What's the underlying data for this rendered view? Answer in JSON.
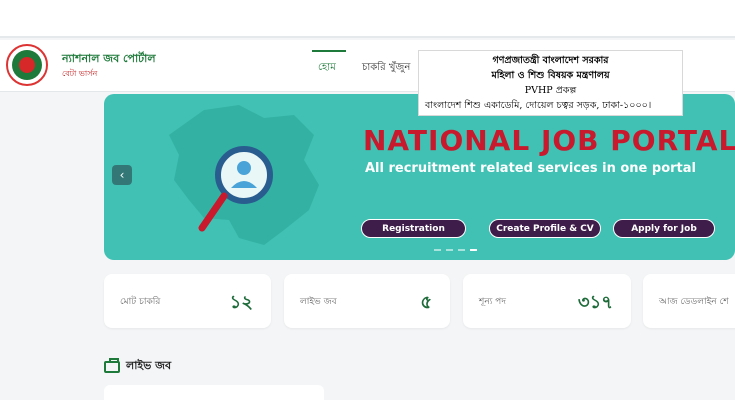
{
  "brand": {
    "title": "ন্যাশনাল জব পোর্টাল",
    "subtitle": "বেটা ভার্সন"
  },
  "nav": {
    "home": "হোম",
    "find_jobs": "চাকরি খুঁজুন"
  },
  "overlay": {
    "line1": "গণপ্রজাতন্ত্রী বাংলাদেশ সরকার",
    "line2": "মহিলা ও শিশু বিষয়ক মন্ত্রণালয়",
    "line3": "PVHP প্রকল্প",
    "line4": "বাংলাদেশ শিশু একাডেমি, দোয়েল চত্বর সড়ক, ঢাকা-১০০০।"
  },
  "banner": {
    "title": "NATIONAL JOB PORTAL",
    "subtitle": "All recruitment related services in one portal",
    "buttons": {
      "registration": "Registration",
      "create_profile": "Create Profile & CV",
      "apply": "Apply for Job"
    },
    "prev_icon": "chevron-left-icon",
    "slide_count": 4,
    "active_slide": 4
  },
  "stats": [
    {
      "label": "মোট চাকরি",
      "value": "১২"
    },
    {
      "label": "লাইভ জব",
      "value": "৫"
    },
    {
      "label": "শূন্য পদ",
      "value": "৩১৭"
    },
    {
      "label": "আজ ডেডলাইন শে",
      "value": ""
    }
  ],
  "live_jobs": {
    "icon": "briefcase-icon",
    "title": "লাইভ জব"
  },
  "colors": {
    "brand_green": "#1e7a3a",
    "banner_teal": "#40c1b3",
    "banner_title_red": "#c8192d",
    "button_purple": "#3f1d4a"
  }
}
